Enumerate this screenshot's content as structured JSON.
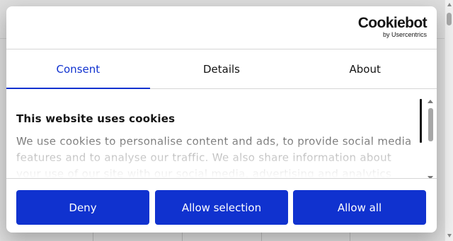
{
  "dialog": {
    "brand": {
      "name": "Cookiebot",
      "sub": "by Usercentrics"
    },
    "tabs": [
      {
        "label": "Consent",
        "active": true
      },
      {
        "label": "Details",
        "active": false
      },
      {
        "label": "About",
        "active": false
      }
    ],
    "content": {
      "title": "This website uses cookies",
      "body": "We use cookies to personalise content and ads, to provide social media features and to analyse our traffic. We also share information about your use of our site with our social media, advertising and analytics partners who may combine it with other information that you've provided to them or that they've collected from your use of their services."
    },
    "buttons": {
      "deny": "Deny",
      "allow_selection": "Allow selection",
      "allow_all": "Allow all"
    }
  },
  "colors": {
    "accent": "#1032cf",
    "text": "#141414",
    "divider": "#d6d6d6"
  },
  "icons": {
    "content_scroll_up": "triangle-up",
    "content_scroll_down": "triangle-down"
  }
}
